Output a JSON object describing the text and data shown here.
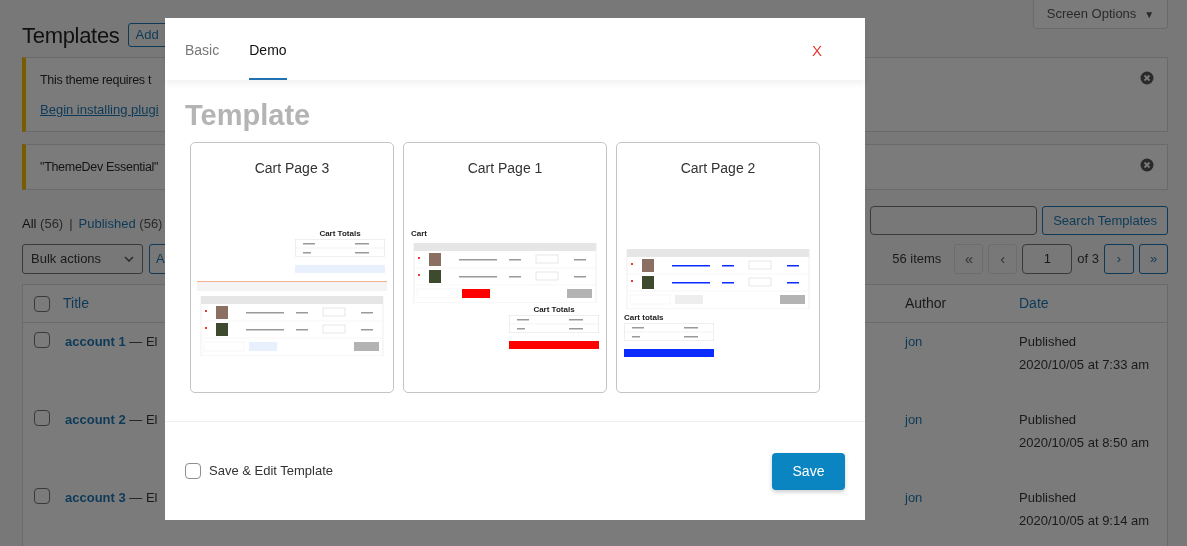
{
  "screen_options": {
    "label": "Screen Options",
    "arrow": "▼"
  },
  "page_title": "Templates",
  "add_button": "Add",
  "notices": [
    {
      "text": "This theme requires t",
      "link": "Begin installing plugi"
    },
    {
      "text": "\"ThemeDev Essential\""
    }
  ],
  "filters": [
    {
      "label": "All",
      "count": "(56)",
      "selected": true
    },
    {
      "label": "Published",
      "count": "(56)",
      "selected": false
    }
  ],
  "filter_separator": "|",
  "bulk_actions": {
    "value": "Bulk actions",
    "apply": "A"
  },
  "search_button": "Search Templates",
  "pagination": {
    "count": "56 items",
    "first": "«",
    "prev": "‹",
    "page": "1",
    "of": "of 3",
    "next": "›",
    "last": "»"
  },
  "table": {
    "columns": [
      "Title",
      "Author",
      "Date"
    ],
    "select_all": {
      "checked": false
    },
    "rows": [
      {
        "checked": false,
        "title": "account 1",
        "suffix": " — El",
        "author": "jon",
        "status": "Published",
        "date": "2020/10/05 at 7:33 am"
      },
      {
        "checked": false,
        "title": "account 2",
        "suffix": " — El",
        "author": "jon",
        "status": "Published",
        "date": "2020/10/05 at 8:50 am"
      },
      {
        "checked": false,
        "title": "account 3",
        "suffix": " — El",
        "author": "jon",
        "status": "Published",
        "date": "2020/10/05 at 9:14 am"
      }
    ]
  },
  "modal": {
    "tabs": [
      {
        "label": "Basic",
        "selected": false
      },
      {
        "label": "Demo",
        "selected": true
      }
    ],
    "close": "X",
    "heading": "Template",
    "templates": [
      {
        "title": "Cart Page 3",
        "kind": "totals_first",
        "color": "#e8f0fe",
        "totals_heading": "Cart Totals"
      },
      {
        "title": "Cart Page 1",
        "kind": "cart_first",
        "color": "#ff0000",
        "cart_heading": "Cart",
        "totals_heading": "Cart Totals"
      },
      {
        "title": "Cart Page 2",
        "kind": "table_first",
        "color": "#0a2cff",
        "totals_heading": "Cart totals"
      }
    ],
    "save_edit": {
      "label": "Save & Edit Template",
      "checked": false
    },
    "save_button": "Save"
  }
}
